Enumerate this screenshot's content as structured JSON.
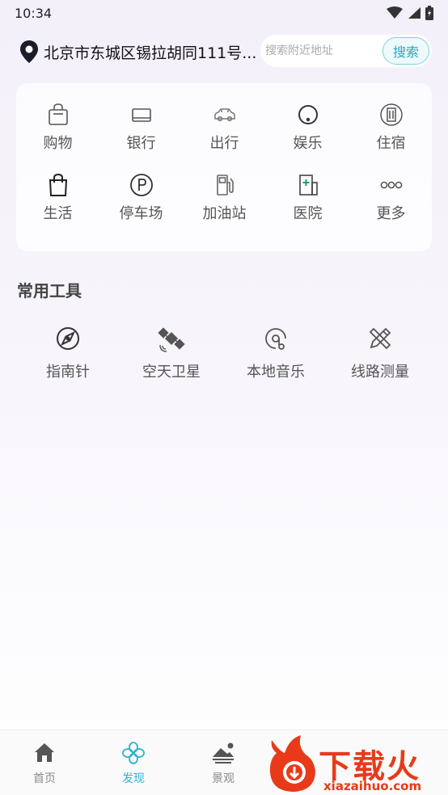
{
  "status": {
    "time": "10:34"
  },
  "location": {
    "address": "北京市东城区锡拉胡同111号..."
  },
  "search": {
    "placeholder": "搜索附近地址",
    "button": "搜索"
  },
  "categories": [
    {
      "label": "购物",
      "icon": "shopping-bag-icon"
    },
    {
      "label": "银行",
      "icon": "bank-card-icon"
    },
    {
      "label": "出行",
      "icon": "car-icon"
    },
    {
      "label": "娱乐",
      "icon": "entertainment-icon"
    },
    {
      "label": "住宿",
      "icon": "hotel-icon"
    },
    {
      "label": "生活",
      "icon": "life-bag-icon"
    },
    {
      "label": "停车场",
      "icon": "parking-icon"
    },
    {
      "label": "加油站",
      "icon": "gas-station-icon"
    },
    {
      "label": "医院",
      "icon": "hospital-icon"
    },
    {
      "label": "更多",
      "icon": "more-icon"
    }
  ],
  "tools": {
    "title": "常用工具",
    "items": [
      {
        "label": "指南针",
        "icon": "compass-icon"
      },
      {
        "label": "空天卫星",
        "icon": "satellite-icon"
      },
      {
        "label": "本地音乐",
        "icon": "music-icon"
      },
      {
        "label": "线路测量",
        "icon": "ruler-pencil-icon"
      }
    ]
  },
  "tabs": [
    {
      "label": "首页",
      "icon": "home-icon"
    },
    {
      "label": "发现",
      "icon": "discover-icon"
    },
    {
      "label": "景观",
      "icon": "landscape-icon"
    }
  ],
  "watermark": {
    "text": "下载火",
    "url": "xiazaihuo.com"
  },
  "colors": {
    "accent": "#2fb3cf",
    "watermark": "#e83a1a"
  }
}
